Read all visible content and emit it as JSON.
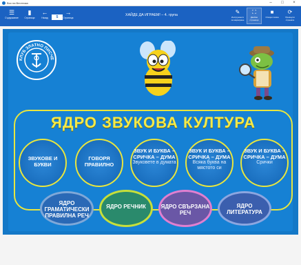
{
  "window": {
    "title": "Box на Вестника"
  },
  "toolbar": {
    "left_items": [
      {
        "icon": "☰",
        "label": "Съдържание"
      },
      {
        "icon": "▮",
        "label": "Страници"
      },
      {
        "icon": "←",
        "label": "Назад"
      },
      {
        "icon": "→",
        "label": "Напред"
      }
    ],
    "page_number": "5",
    "page_label": "Страница",
    "title": "ХАЙДЕ ДА ИГРАЕМ! – 4. група",
    "right_items": [
      {
        "icon": "✎",
        "label": "Инструменти за маркиране"
      },
      {
        "icon": "⛶",
        "label": "Двойни страници"
      },
      {
        "icon": "■",
        "label": "Отвори папка"
      },
      {
        "icon": "⟳",
        "label": "Превърти страната"
      }
    ]
  },
  "logo": {
    "text": "КЛУБ ЗЛАТНО ПИСЧЕ"
  },
  "main": {
    "title": "ЯДРО ЗВУКОВА КУЛТУРА",
    "circles": [
      {
        "title": "ЗВУКОВЕ И БУКВИ",
        "subtitle": ""
      },
      {
        "title": "ГОВОРЯ ПРАВИЛНО",
        "subtitle": ""
      },
      {
        "title": "ЗВУК И БУКВА – СРИЧКА – ДУМА",
        "subtitle": "Звуковете в думата"
      },
      {
        "title": "ЗВУК И БУКВА – СРИЧКА – ДУМА",
        "subtitle": "Всяка буква на мястото си"
      },
      {
        "title": "ЗВУК И БУКВА – СРИЧКА – ДУМА",
        "subtitle": "Срички"
      }
    ]
  },
  "bottom": [
    {
      "label": "ЯДРО ГРАМАТИЧЕСКИ ПРАВИЛНА РЕЧ",
      "color": "#7fa8d8"
    },
    {
      "label": "ЯДРО РЕЧНИК",
      "color": "#c7df3a"
    },
    {
      "label": "ЯДРО СВЪРЗАНА РЕЧ",
      "color": "#e07fd0"
    },
    {
      "label": "ЯДРО ЛИТЕРАТУРА",
      "color": "#8ca6e0"
    }
  ],
  "colors": {
    "toolbar": "#1b62c2",
    "panel": "#1478c7",
    "accent": "#e9e63e"
  }
}
